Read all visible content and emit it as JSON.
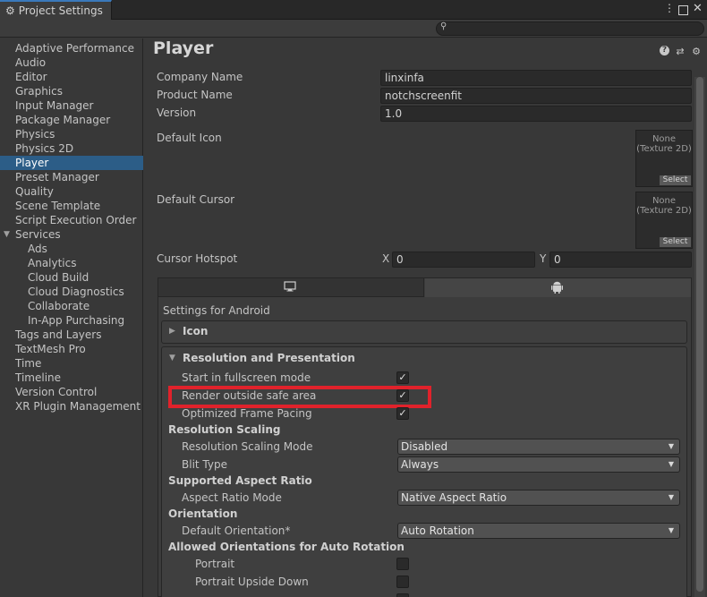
{
  "window": {
    "tab_title": "Project Settings",
    "tab_icon": "gear-icon",
    "controls": {
      "kebab": "⋮",
      "close": "✕"
    }
  },
  "search": {
    "placeholder": "",
    "icon": "search-icon"
  },
  "sidebar": {
    "items": [
      {
        "label": "Adaptive Performance"
      },
      {
        "label": "Audio"
      },
      {
        "label": "Editor"
      },
      {
        "label": "Graphics"
      },
      {
        "label": "Input Manager"
      },
      {
        "label": "Package Manager"
      },
      {
        "label": "Physics"
      },
      {
        "label": "Physics 2D"
      },
      {
        "label": "Player",
        "selected": true
      },
      {
        "label": "Preset Manager"
      },
      {
        "label": "Quality"
      },
      {
        "label": "Scene Template"
      },
      {
        "label": "Script Execution Order"
      },
      {
        "label": "Services",
        "expanded": true
      },
      {
        "label": "Ads",
        "child": true
      },
      {
        "label": "Analytics",
        "child": true
      },
      {
        "label": "Cloud Build",
        "child": true
      },
      {
        "label": "Cloud Diagnostics",
        "child": true
      },
      {
        "label": "Collaborate",
        "child": true
      },
      {
        "label": "In-App Purchasing",
        "child": true
      },
      {
        "label": "Tags and Layers"
      },
      {
        "label": "TextMesh Pro"
      },
      {
        "label": "Time"
      },
      {
        "label": "Timeline"
      },
      {
        "label": "Version Control"
      },
      {
        "label": "XR Plugin Management"
      }
    ]
  },
  "player": {
    "title": "Player",
    "header_icons": [
      "help-icon",
      "presets-icon",
      "settings-icon"
    ],
    "company_name_label": "Company Name",
    "company_name": "linxinfa",
    "product_name_label": "Product Name",
    "product_name": "notchscreenfit",
    "version_label": "Version",
    "version": "1.0",
    "default_icon_label": "Default Icon",
    "default_cursor_label": "Default Cursor",
    "slot_none": "None",
    "slot_type": "(Texture 2D)",
    "slot_select": "Select",
    "cursor_hotspot_label": "Cursor Hotspot",
    "hotspot_x_label": "X",
    "hotspot_x": "0",
    "hotspot_y_label": "Y",
    "hotspot_y": "0"
  },
  "platform": {
    "tabs": [
      "desktop-icon",
      "android-icon"
    ],
    "settings_for": "Settings for Android",
    "icon_section": "Icon",
    "resolution_section": "Resolution and Presentation",
    "start_fullscreen_label": "Start in fullscreen mode",
    "start_fullscreen": true,
    "render_outside_label": "Render outside safe area",
    "render_outside": true,
    "optimized_frame_label": "Optimized Frame Pacing",
    "optimized_frame": true,
    "resolution_scaling_header": "Resolution Scaling",
    "resolution_scaling_mode_label": "Resolution Scaling Mode",
    "resolution_scaling_mode": "Disabled",
    "blit_type_label": "Blit Type",
    "blit_type": "Always",
    "supported_aspect_header": "Supported Aspect Ratio",
    "aspect_ratio_mode_label": "Aspect Ratio Mode",
    "aspect_ratio_mode": "Native Aspect Ratio",
    "orientation_header": "Orientation",
    "default_orientation_label": "Default Orientation*",
    "default_orientation": "Auto Rotation",
    "allowed_orientations_header": "Allowed Orientations for Auto Rotation",
    "portrait_label": "Portrait",
    "portrait": false,
    "portrait_upside_down_label": "Portrait Upside Down",
    "portrait_upside_down": false
  },
  "colors": {
    "selection": "#2c5d87",
    "highlight_box": "#e0222b",
    "panel_bg": "#383838"
  }
}
